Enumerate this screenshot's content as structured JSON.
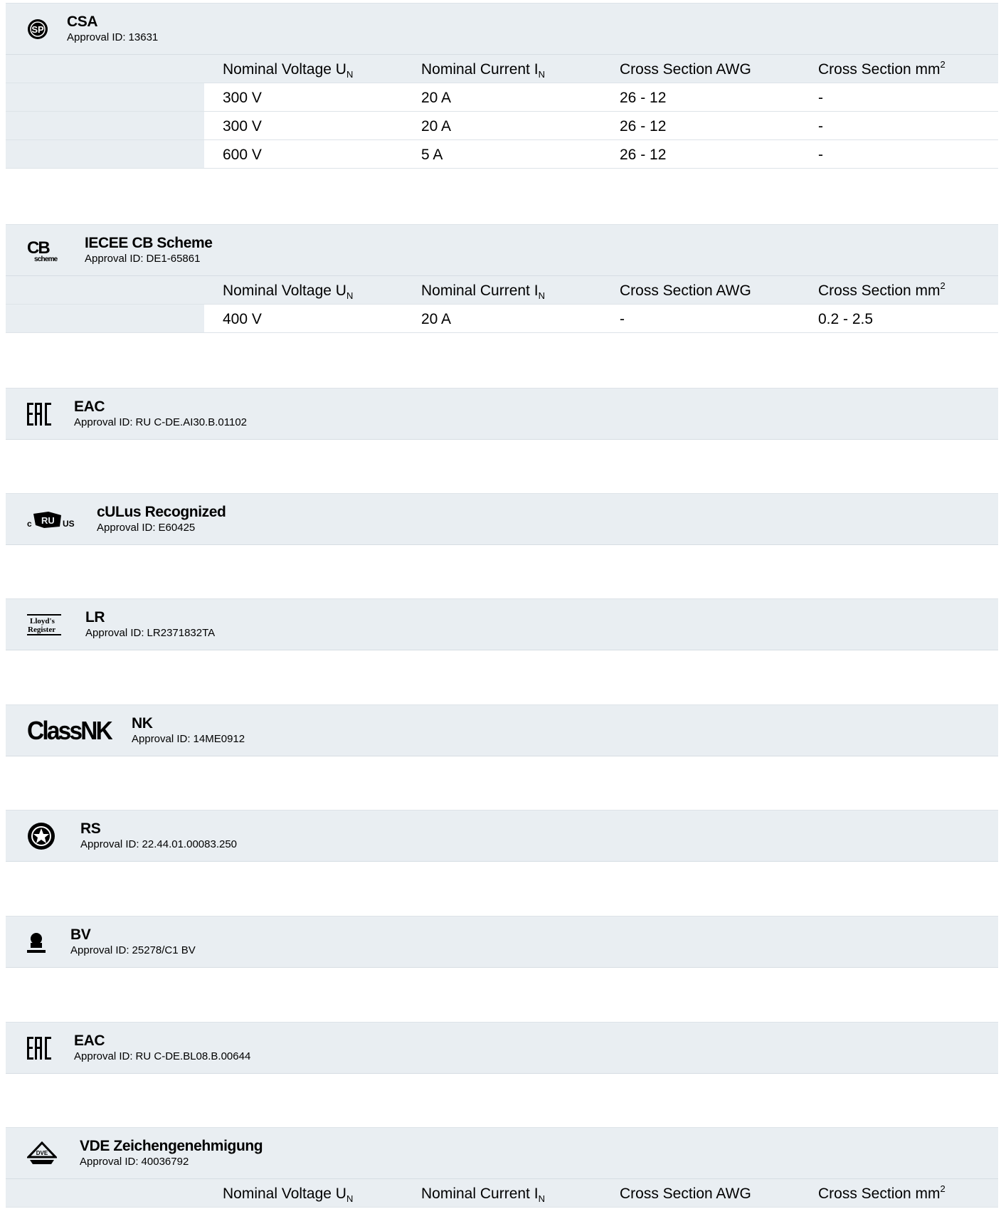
{
  "columns": {
    "voltage": "Nominal Voltage U",
    "voltage_sub": "N",
    "current": "Nominal Current I",
    "current_sub": "N",
    "awg": "Cross Section AWG",
    "mm2": "Cross Section mm",
    "mm2_sup": "2"
  },
  "approval_id_label": "Approval ID:",
  "sections": [
    {
      "name": "CSA",
      "id": "13631",
      "icon": "csa-logo-icon",
      "rows": [
        [
          "300 V",
          "20 A",
          "26 - 12",
          "-"
        ],
        [
          "300 V",
          "20 A",
          "26 - 12",
          "-"
        ],
        [
          "600 V",
          "5 A",
          "26 - 12",
          "-"
        ]
      ]
    },
    {
      "name": "IECEE CB Scheme",
      "id": "DE1-65861",
      "icon": "cb-scheme-logo-icon",
      "rows": [
        [
          "400 V",
          "20 A",
          "-",
          "0.2 - 2.5"
        ]
      ]
    },
    {
      "name": "EAC",
      "id": "RU C-DE.AI30.B.01102",
      "icon": "eac-logo-icon",
      "rows": []
    },
    {
      "name": "cULus Recognized",
      "id": "E60425",
      "icon": "culus-logo-icon",
      "rows": []
    },
    {
      "name": "LR",
      "id": "LR2371832TA",
      "icon": "lloyds-register-logo-icon",
      "rows": []
    },
    {
      "name": "NK",
      "id": "14ME0912",
      "icon": "classnk-logo-icon",
      "logo_text": "ClassNK",
      "rows": []
    },
    {
      "name": "RS",
      "id": "22.44.01.00083.250",
      "icon": "rs-logo-icon",
      "rows": []
    },
    {
      "name": "BV",
      "id": "25278/C1 BV",
      "icon": "bv-logo-icon",
      "rows": []
    },
    {
      "name": "EAC",
      "id": "RU C-DE.BL08.B.00644",
      "icon": "eac-logo-icon",
      "rows": []
    },
    {
      "name": "VDE Zeichengenehmigung",
      "id": "40036792",
      "icon": "vde-logo-icon",
      "rows": []
    }
  ]
}
